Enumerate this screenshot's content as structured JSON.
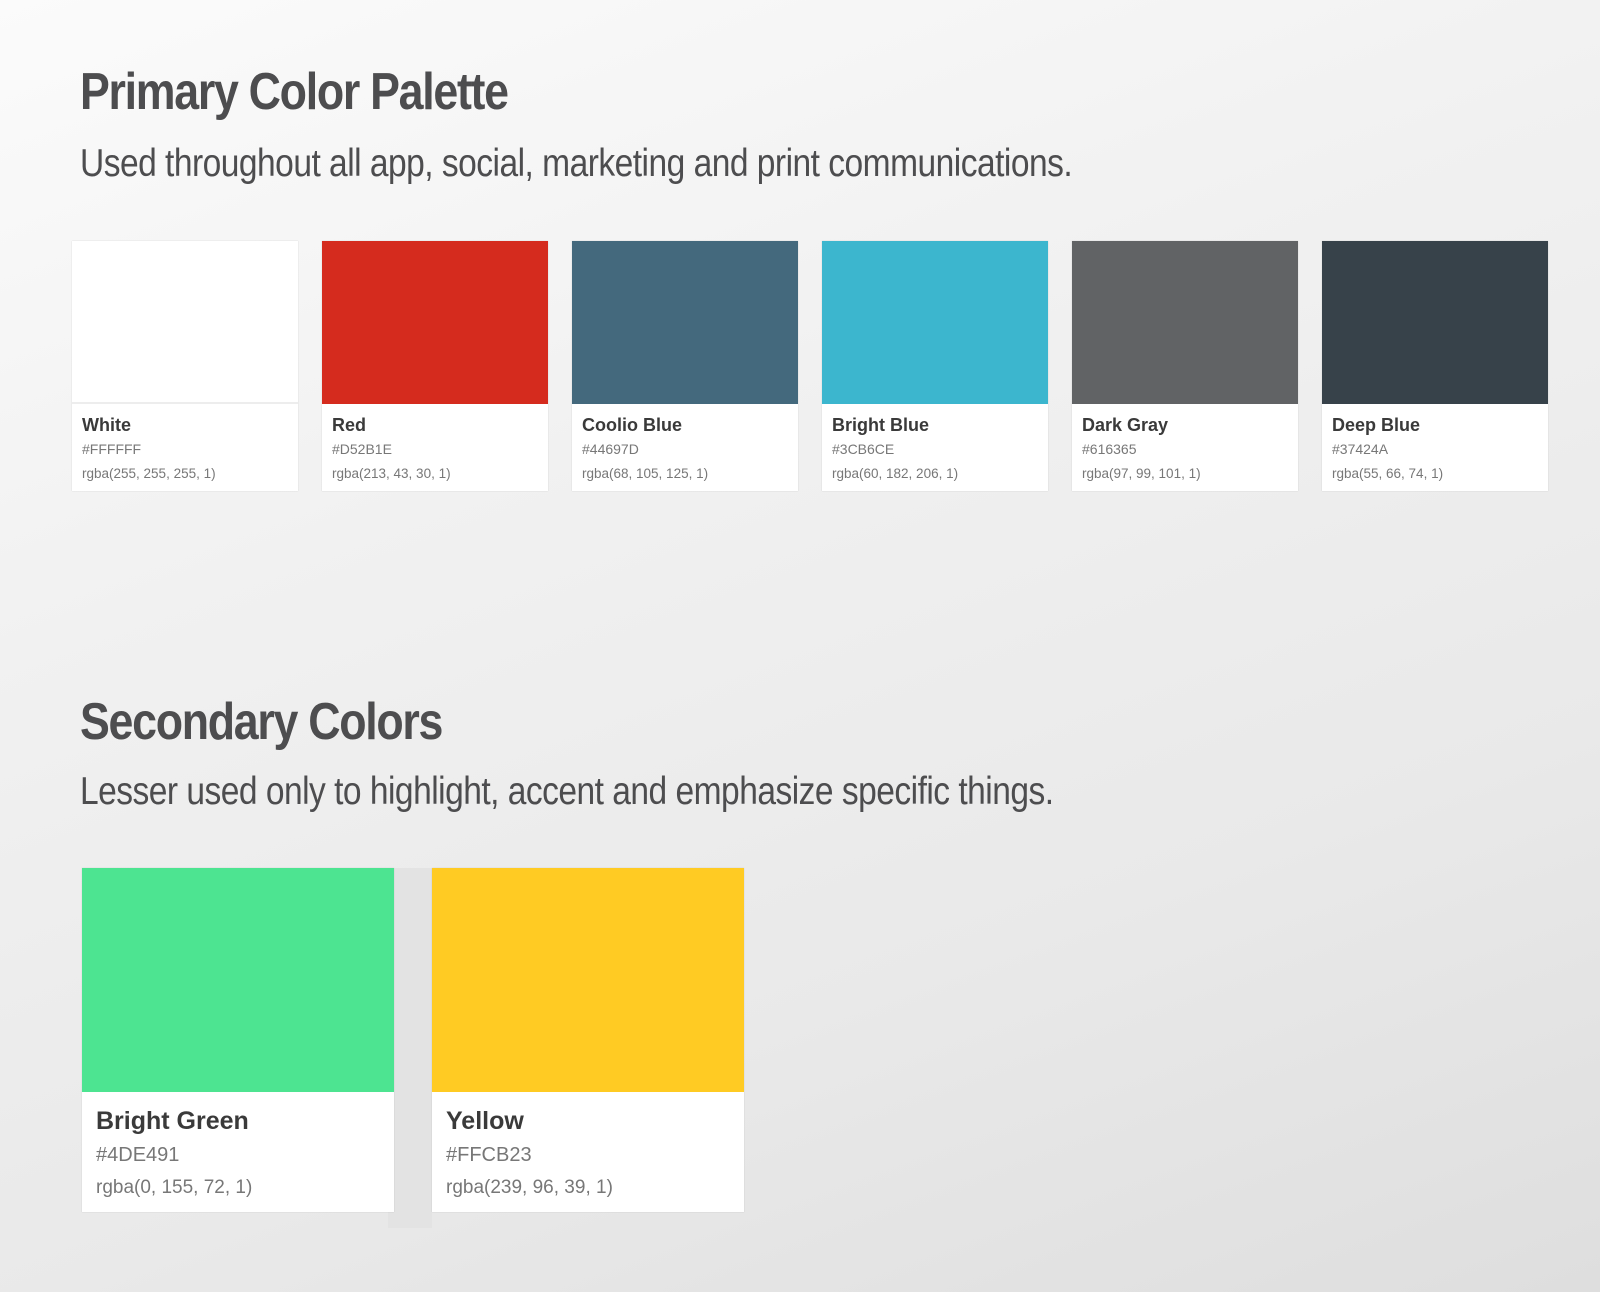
{
  "primary": {
    "title": "Primary Color Palette",
    "subtitle": "Used throughout all app, social, marketing and print communications.",
    "swatches": [
      {
        "name": "White",
        "hex": "#FFFFFF",
        "rgba": "rgba(255, 255, 255, 1)",
        "color": "#FFFFFF"
      },
      {
        "name": "Red",
        "hex": "#D52B1E",
        "rgba": "rgba(213, 43, 30, 1)",
        "color": "#D52B1E"
      },
      {
        "name": "Coolio Blue",
        "hex": "#44697D",
        "rgba": "rgba(68, 105, 125, 1)",
        "color": "#44697D"
      },
      {
        "name": "Bright Blue",
        "hex": "#3CB6CE",
        "rgba": "rgba(60, 182, 206, 1)",
        "color": "#3CB6CE"
      },
      {
        "name": "Dark Gray",
        "hex": "#616365",
        "rgba": "rgba(97, 99, 101, 1)",
        "color": "#616365"
      },
      {
        "name": "Deep Blue",
        "hex": "#37424A",
        "rgba": "rgba(55, 66, 74, 1)",
        "color": "#37424A"
      }
    ]
  },
  "secondary": {
    "title": "Secondary Colors",
    "subtitle": "Lesser used only to highlight, accent and emphasize specific things.",
    "swatches": [
      {
        "name": "Bright Green",
        "hex": "#4DE491",
        "rgba": "rgba(0, 155, 72, 1)",
        "color": "#4DE491"
      },
      {
        "name": "Yellow",
        "hex": "#FFCB23",
        "rgba": "rgba(239, 96, 39, 1)",
        "color": "#FFCB23"
      }
    ]
  }
}
